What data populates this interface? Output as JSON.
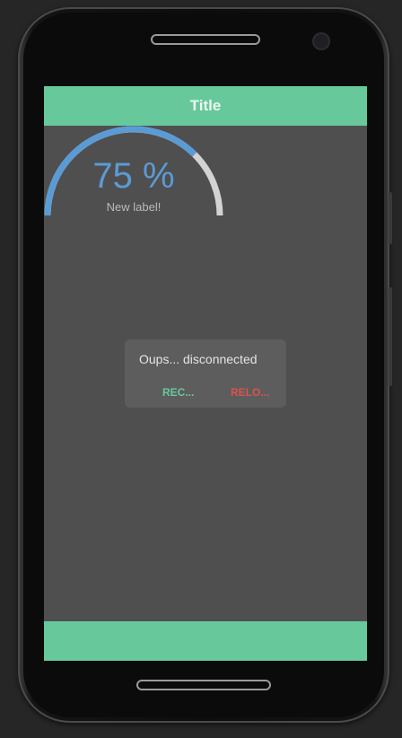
{
  "app": {
    "title": "Title"
  },
  "gauge": {
    "value_text": "75 %",
    "label": "New label!",
    "percent": 75,
    "progress_color": "#5b9bd5",
    "track_color": "#d3d3d3"
  },
  "dialog": {
    "message": "Oups... disconnected",
    "reconnect_label": "REC...",
    "reload_label": "RELO..."
  },
  "colors": {
    "accent": "#67c99b",
    "danger": "#d9534f",
    "screen_background": "#4f4f4f"
  }
}
